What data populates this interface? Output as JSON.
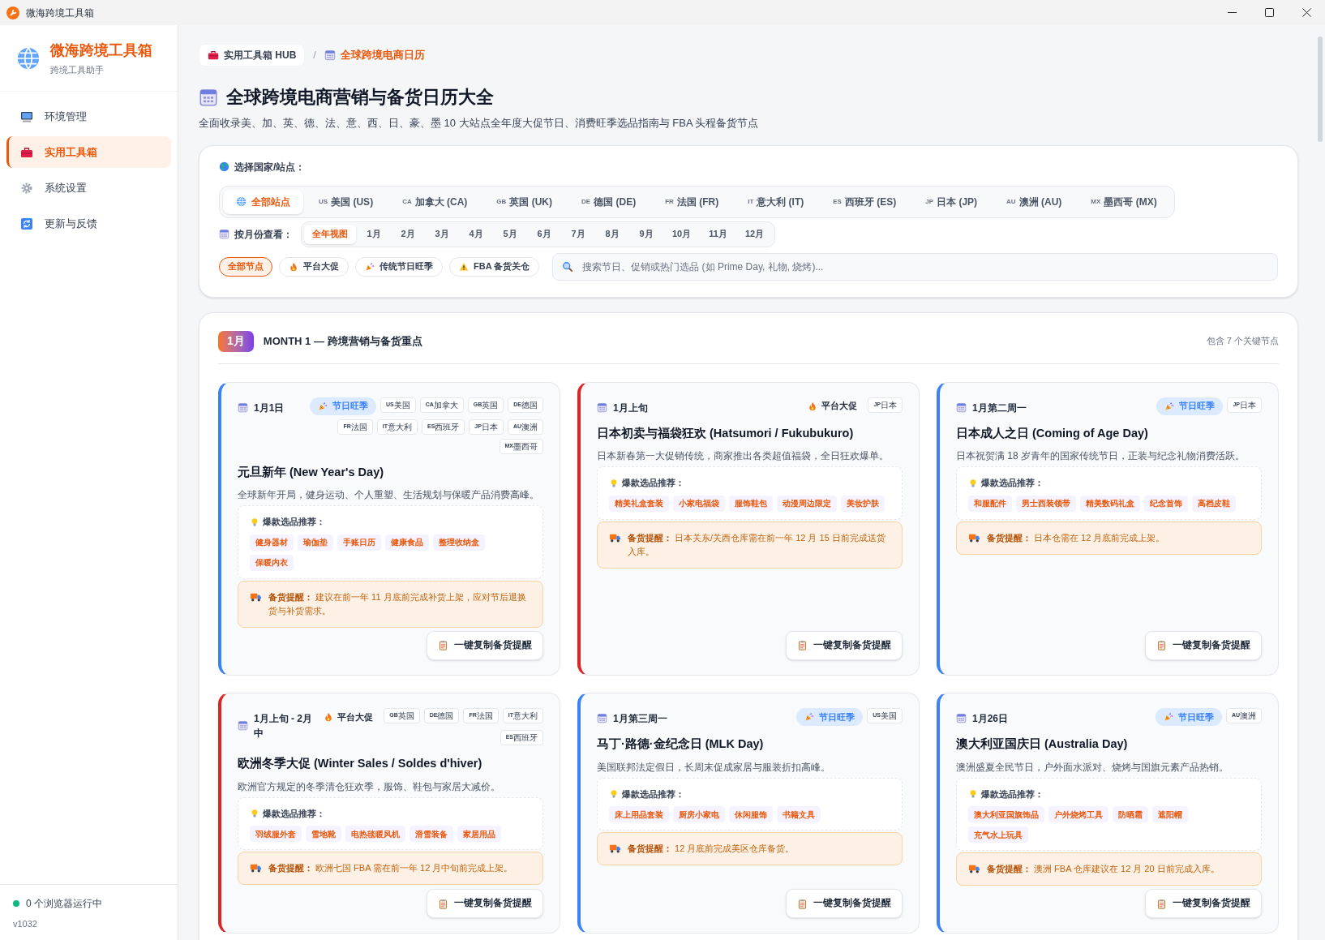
{
  "window": {
    "title": "微海跨境工具箱"
  },
  "sidebar": {
    "brand": "微海跨境工具箱",
    "subtitle": "跨境工具助手",
    "items": [
      {
        "label": "环境管理",
        "selected": false
      },
      {
        "label": "实用工具箱",
        "selected": true
      },
      {
        "label": "系统设置",
        "selected": false
      },
      {
        "label": "更新与反馈",
        "selected": false
      }
    ],
    "status": "0 个浏览器运行中",
    "version": "v1032"
  },
  "breadcrumb": [
    {
      "label": "实用工具箱 HUB",
      "current": false
    },
    {
      "label": "全球跨境电商日历",
      "current": true
    }
  ],
  "breadcrumb_separator": "/",
  "page": {
    "title": "全球跨境电商营销与备货日历大全",
    "subtitle": "全面收录美、加、英、德、法、意、西、日、豪、墨 10 大站点全年度大促节日、消费旺季选品指南与 FBA 头程备货节点"
  },
  "filters": {
    "country_label": "选择国家/站点：",
    "countries": [
      {
        "label": "全部站点",
        "selected": true
      },
      {
        "code": "US",
        "label": "美国 (US)",
        "selected": false
      },
      {
        "code": "CA",
        "label": "加拿大 (CA)",
        "selected": false
      },
      {
        "code": "GB",
        "label": "英国 (UK)",
        "selected": false
      },
      {
        "code": "DE",
        "label": "德国 (DE)",
        "selected": false
      },
      {
        "code": "FR",
        "label": "法国 (FR)",
        "selected": false
      },
      {
        "code": "IT",
        "label": "意大利 (IT)",
        "selected": false
      },
      {
        "code": "ES",
        "label": "西班牙 (ES)",
        "selected": false
      },
      {
        "code": "JP",
        "label": "日本 (JP)",
        "selected": false
      },
      {
        "code": "AU",
        "label": "澳洲 (AU)",
        "selected": false
      },
      {
        "code": "MX",
        "label": "墨西哥 (MX)",
        "selected": false
      }
    ],
    "month_label": "按月份查看：",
    "months": [
      {
        "label": "全年视图",
        "selected": true
      },
      {
        "label": "1月",
        "selected": false
      },
      {
        "label": "2月",
        "selected": false
      },
      {
        "label": "3月",
        "selected": false
      },
      {
        "label": "4月",
        "selected": false
      },
      {
        "label": "5月",
        "selected": false
      },
      {
        "label": "6月",
        "selected": false
      },
      {
        "label": "7月",
        "selected": false
      },
      {
        "label": "8月",
        "selected": false
      },
      {
        "label": "9月",
        "selected": false
      },
      {
        "label": "10月",
        "selected": false
      },
      {
        "label": "11月",
        "selected": false
      },
      {
        "label": "12月",
        "selected": false
      }
    ],
    "categories": [
      {
        "label": "全部节点",
        "selected": true
      },
      {
        "label": "平台大促",
        "selected": false
      },
      {
        "label": "传统节日旺季",
        "selected": false
      },
      {
        "label": "FBA 备货关仓",
        "selected": false
      }
    ],
    "search": {
      "placeholder": "搜索节日、促销或热门选品 (如 Prime Day, 礼物, 烧烤)..."
    }
  },
  "month": {
    "badge": "1月",
    "title": "MONTH 1 — 跨境营销与备货重点",
    "count": "包含 7 个关键节点",
    "events": [
      {
        "kind": "holiday",
        "date": "1月1日",
        "tag": "节日旺季",
        "countries": [
          {
            "code": "US",
            "name": "美国"
          },
          {
            "code": "CA",
            "name": "加拿大"
          },
          {
            "code": "GB",
            "name": "英国"
          },
          {
            "code": "DE",
            "name": "德国"
          },
          {
            "code": "FR",
            "name": "法国"
          },
          {
            "code": "IT",
            "name": "意大利"
          },
          {
            "code": "ES",
            "name": "西班牙"
          },
          {
            "code": "JP",
            "name": "日本"
          },
          {
            "code": "AU",
            "name": "澳洲"
          },
          {
            "code": "MX",
            "name": "墨西哥"
          }
        ],
        "title": "元旦新年 (New Year's Day)",
        "desc": "全球新年开局，健身运动、个人重塑、生活规划与保暖产品消费高峰。",
        "picks_label": "爆款选品推荐：",
        "picks": [
          "健身器材",
          "瑜伽垫",
          "手账日历",
          "健康食品",
          "整理收纳盒",
          "保暖内衣"
        ],
        "reminder_label": "备货提醒：",
        "reminder": "建议在前一年 11 月底前完成补货上架，应对节后退换货与补货需求。",
        "button": "一键复制备货提醒"
      },
      {
        "kind": "platform",
        "date": "1月上旬",
        "tag": "平台大促",
        "countries": [
          {
            "code": "JP",
            "name": "日本"
          }
        ],
        "title": "日本初卖与福袋狂欢 (Hatsumori / Fukubukuro)",
        "desc": "日本新春第一大促销传统，商家推出各类超值福袋，全日狂欢爆单。",
        "picks_label": "爆款选品推荐：",
        "picks": [
          "精美礼盒套装",
          "小家电福袋",
          "服饰鞋包",
          "动漫周边限定",
          "美妆护肤"
        ],
        "reminder_label": "备货提醒：",
        "reminder": "日本关东/关西仓库需在前一年 12 月 15 日前完成送货入库。",
        "button": "一键复制备货提醒"
      },
      {
        "kind": "holiday",
        "date": "1月第二周一",
        "tag": "节日旺季",
        "countries": [
          {
            "code": "JP",
            "name": "日本"
          }
        ],
        "title": "日本成人之日 (Coming of Age Day)",
        "desc": "日本祝贺满 18 岁青年的国家传统节日，正装与纪念礼物消费活跃。",
        "picks_label": "爆款选品推荐：",
        "picks": [
          "和服配件",
          "男士西装领带",
          "精美数码礼盒",
          "纪念首饰",
          "高档皮鞋"
        ],
        "reminder_label": "备货提醒：",
        "reminder": "日本仓需在 12 月底前完成上架。",
        "button": "一键复制备货提醒"
      },
      {
        "kind": "platform",
        "date": "1月上旬 - 2月中",
        "tag": "平台大促",
        "countries": [
          {
            "code": "GB",
            "name": "英国"
          },
          {
            "code": "DE",
            "name": "德国"
          },
          {
            "code": "FR",
            "name": "法国"
          },
          {
            "code": "IT",
            "name": "意大利"
          },
          {
            "code": "ES",
            "name": "西班牙"
          }
        ],
        "title": "欧洲冬季大促 (Winter Sales / Soldes d'hiver)",
        "desc": "欧洲官方规定的冬季清仓狂欢季，服饰、鞋包与家居大减价。",
        "picks_label": "爆款选品推荐：",
        "picks": [
          "羽绒服外套",
          "雪地靴",
          "电热毯暖风机",
          "滑雪装备",
          "家居用品"
        ],
        "reminder_label": "备货提醒：",
        "reminder": "欧洲七国 FBA 需在前一年 12 月中旬前完成上架。",
        "button": "一键复制备货提醒"
      },
      {
        "kind": "holiday",
        "date": "1月第三周一",
        "tag": "节日旺季",
        "countries": [
          {
            "code": "US",
            "name": "美国"
          }
        ],
        "title": "马丁·路德·金纪念日 (MLK Day)",
        "desc": "美国联邦法定假日，长周末促成家居与服装折扣高峰。",
        "picks_label": "爆款选品推荐：",
        "picks": [
          "床上用品套装",
          "厨房小家电",
          "休闲服饰",
          "书籍文具"
        ],
        "reminder_label": "备货提醒：",
        "reminder": "12 月底前完成美区仓库备货。",
        "button": "一键复制备货提醒"
      },
      {
        "kind": "holiday",
        "date": "1月26日",
        "tag": "节日旺季",
        "countries": [
          {
            "code": "AU",
            "name": "澳洲"
          }
        ],
        "title": "澳大利亚国庆日 (Australia Day)",
        "desc": "澳洲盛夏全民节日，户外面水派对、烧烤与国旗元素产品热销。",
        "picks_label": "爆款选品推荐：",
        "picks": [
          "澳大利亚国旗饰品",
          "户外烧烤工具",
          "防晒霜",
          "遮阳帽",
          "充气水上玩具"
        ],
        "reminder_label": "备货提醒：",
        "reminder": "澳洲 FBA 仓库建议在 12 月 20 日前完成入库。",
        "button": "一键复制备货提醒"
      }
    ]
  }
}
